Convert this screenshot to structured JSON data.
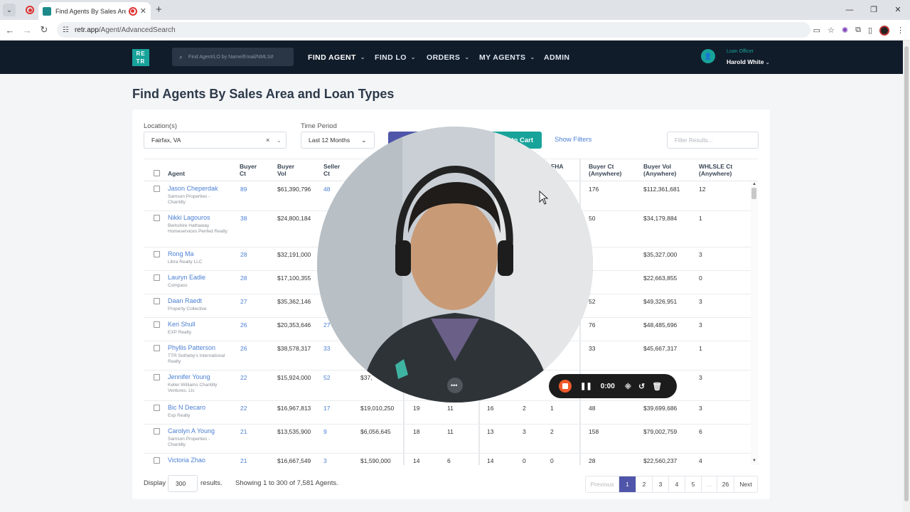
{
  "browser": {
    "tab_title": "Find Agents By Sales Area a",
    "url_host": "retr.app",
    "url_path": "/Agent/AdvancedSearch"
  },
  "nav": {
    "logo_text": "RE TR",
    "search_placeholder": "Find Agent/LO by Name/Email/NMLS#",
    "menu": [
      "FIND AGENT",
      "FIND LO",
      "ORDERS",
      "MY AGENTS",
      "ADMIN"
    ],
    "user_role": "Loan Officer",
    "user_name": "Harold White"
  },
  "page": {
    "title": "Find Agents By Sales Area and Loan Types",
    "location_label": "Location(s)",
    "location_value": "Fairfax, VA",
    "period_label": "Time Period",
    "period_value": "Last 12 Months",
    "add_cart_label": "to Cart",
    "show_filters": "Show Filters",
    "filter_placeholder": "Filter Results..."
  },
  "table": {
    "headers": {
      "agent": "Agent",
      "buyer_ct": "Buyer Ct",
      "buyer_vol": "Buyer Vol",
      "seller_ct": "Seller Ct",
      "fha": "FHA",
      "buyer_ct_any": "Buyer Ct (Anywhere)",
      "buyer_vol_any": "Buyer Vol (Anywhere)",
      "whlsle_any": "WHLSLE Ct (Anywhere)"
    },
    "rows": [
      {
        "name": "Jason Cheperdak",
        "agency": "Samson Properties - Chantilly",
        "buyer_ct": "89",
        "buyer_vol": "$61,390,796",
        "seller_ct": "48",
        "seller_vol": "",
        "c1": "",
        "c2": "",
        "c3": "",
        "c4": "",
        "c5": "",
        "any_ct": "176",
        "any_vol": "$112,361,681",
        "whl": "12"
      },
      {
        "name": "Nikki Lagouros",
        "agency": "Berkshire Hathaway Homeservices Penfed Realty",
        "buyer_ct": "38",
        "buyer_vol": "$24,800,184",
        "seller_ct": "",
        "seller_vol": "",
        "c1": "",
        "c2": "",
        "c3": "",
        "c4": "",
        "c5": "",
        "any_ct": "50",
        "any_vol": "$34,179,884",
        "whl": "1"
      },
      {
        "name": "Rong Ma",
        "agency": "Libra Realty LLC",
        "buyer_ct": "28",
        "buyer_vol": "$32,191,000",
        "seller_ct": "",
        "seller_vol": "",
        "c1": "",
        "c2": "",
        "c3": "",
        "c4": "",
        "c5": "",
        "any_ct": "3",
        "any_vol": "$35,327,000",
        "whl": "3"
      },
      {
        "name": "Lauryn Eadie",
        "agency": "Compass",
        "buyer_ct": "28",
        "buyer_vol": "$17,100,355",
        "seller_ct": "",
        "seller_vol": "",
        "c1": "",
        "c2": "",
        "c3": "",
        "c4": "",
        "c5": "",
        "any_ct": "6",
        "any_vol": "$22,663,855",
        "whl": "0"
      },
      {
        "name": "Daan Raedt",
        "agency": "Property Collective",
        "buyer_ct": "27",
        "buyer_vol": "$35,362,146",
        "seller_ct": "",
        "seller_vol": "",
        "c1": "",
        "c2": "",
        "c3": "",
        "c4": "",
        "c5": "",
        "any_ct": "52",
        "any_vol": "$49,326,951",
        "whl": "3"
      },
      {
        "name": "Keri Shull",
        "agency": "EXP Realty",
        "buyer_ct": "26",
        "buyer_vol": "$20,353,646",
        "seller_ct": "27",
        "seller_vol": "",
        "c1": "",
        "c2": "",
        "c3": "",
        "c4": "",
        "c5": "",
        "any_ct": "76",
        "any_vol": "$48,485,696",
        "whl": "3"
      },
      {
        "name": "Phyllis Patterson",
        "agency": "TTR Sotheby's International Realty",
        "buyer_ct": "26",
        "buyer_vol": "$38,578,317",
        "seller_ct": "33",
        "seller_vol": "",
        "c1": "",
        "c2": "",
        "c3": "",
        "c4": "",
        "c5": "",
        "any_ct": "33",
        "any_vol": "$45,667,317",
        "whl": "1"
      },
      {
        "name": "Jennifer Young",
        "agency": "Keller Williams Chantilly Ventures, Llc",
        "buyer_ct": "22",
        "buyer_vol": "$15,924,000",
        "seller_ct": "52",
        "seller_vol": "$37,",
        "c1": "",
        "c2": "",
        "c3": "",
        "c4": "",
        "c5": "",
        "any_ct": "",
        "any_vol": "",
        "whl": "3"
      },
      {
        "name": "Bic N Decaro",
        "agency": "Exp Realty",
        "buyer_ct": "22",
        "buyer_vol": "$16,967,813",
        "seller_ct": "17",
        "seller_vol": "$19,010,250",
        "c1": "19",
        "c2": "11",
        "c3": "16",
        "c4": "2",
        "c5": "1",
        "any_ct": "48",
        "any_vol": "$39,699,686",
        "whl": "3"
      },
      {
        "name": "Carolyn A Young",
        "agency": "Samson Properties - Chantilly",
        "buyer_ct": "21",
        "buyer_vol": "$13,535,900",
        "seller_ct": "9",
        "seller_vol": "$6,056,645",
        "c1": "18",
        "c2": "11",
        "c3": "13",
        "c4": "3",
        "c5": "2",
        "any_ct": "158",
        "any_vol": "$79,002,759",
        "whl": "6"
      },
      {
        "name": "Victoria Zhao",
        "agency": "",
        "buyer_ct": "21",
        "buyer_vol": "$16,667,549",
        "seller_ct": "3",
        "seller_vol": "$1,590,000",
        "c1": "14",
        "c2": "6",
        "c3": "14",
        "c4": "0",
        "c5": "0",
        "any_ct": "28",
        "any_vol": "$22,560,237",
        "whl": "4"
      }
    ]
  },
  "footer": {
    "display_label": "Display",
    "display_value": "300",
    "results_label": "results.",
    "showing": "Showing 1 to 300 of 7,581 Agents.",
    "pager": [
      "Previous",
      "1",
      "2",
      "3",
      "4",
      "5",
      "...",
      "26",
      "Next"
    ]
  },
  "recorder": {
    "time": "0:00"
  }
}
